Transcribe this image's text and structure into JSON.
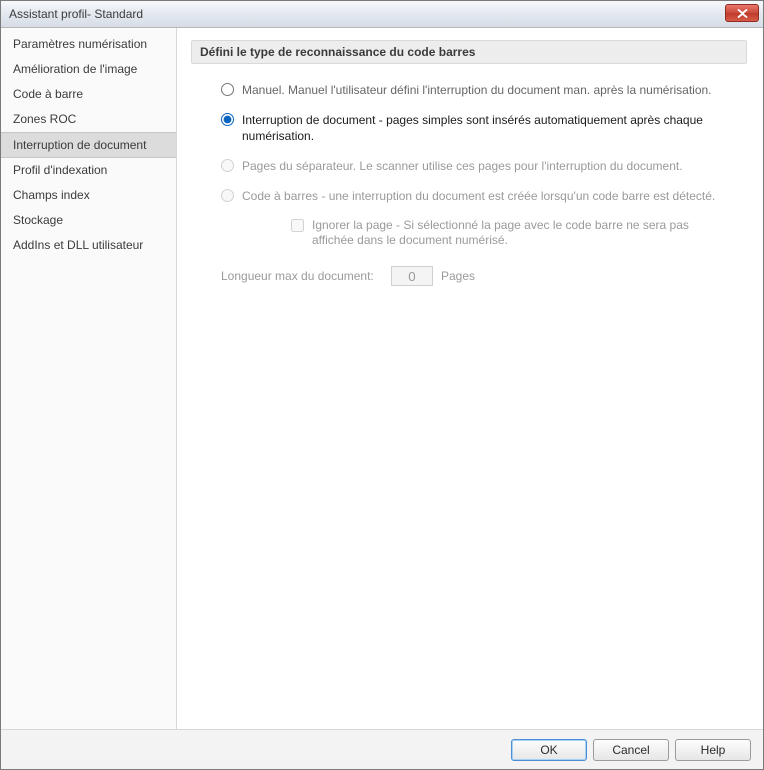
{
  "window": {
    "title": "Assistant profil- Standard"
  },
  "sidebar": {
    "items": [
      {
        "label": "Paramètres numérisation",
        "selected": false
      },
      {
        "label": "Amélioration de l'image",
        "selected": false
      },
      {
        "label": "Code à barre",
        "selected": false
      },
      {
        "label": "Zones ROC",
        "selected": false
      },
      {
        "label": "Interruption de document",
        "selected": true
      },
      {
        "label": "Profil d'indexation",
        "selected": false
      },
      {
        "label": "Champs index",
        "selected": false
      },
      {
        "label": "Stockage",
        "selected": false
      },
      {
        "label": "AddIns et DLL utilisateur",
        "selected": false
      }
    ]
  },
  "group": {
    "header": "Défini le type de reconnaissance du code barres"
  },
  "options": {
    "manual": {
      "label": "Manuel. Manuel l'utilisateur défini l'interruption du document man. après la numérisation.",
      "checked": false,
      "enabled": true
    },
    "docbreak": {
      "label": "Interruption de document  - pages simples sont insérés automatiquement après chaque numérisation.",
      "checked": true,
      "enabled": true
    },
    "separator": {
      "label": "Pages du séparateur. Le scanner utilise ces pages pour l'interruption du document.",
      "checked": false,
      "enabled": false
    },
    "barcode": {
      "label": "Code à barres - une interruption du document est créée lorsqu'un code barre est détecté.",
      "checked": false,
      "enabled": false
    }
  },
  "ignorePage": {
    "label": "Ignorer la page - Si sélectionné la page avec le code barre ne sera pas affichée dans le document numérisé.",
    "checked": false,
    "enabled": false
  },
  "maxLen": {
    "label": "Longueur max du document:",
    "value": "0",
    "unit": "Pages",
    "enabled": false
  },
  "footer": {
    "ok": "OK",
    "cancel": "Cancel",
    "help": "Help"
  }
}
